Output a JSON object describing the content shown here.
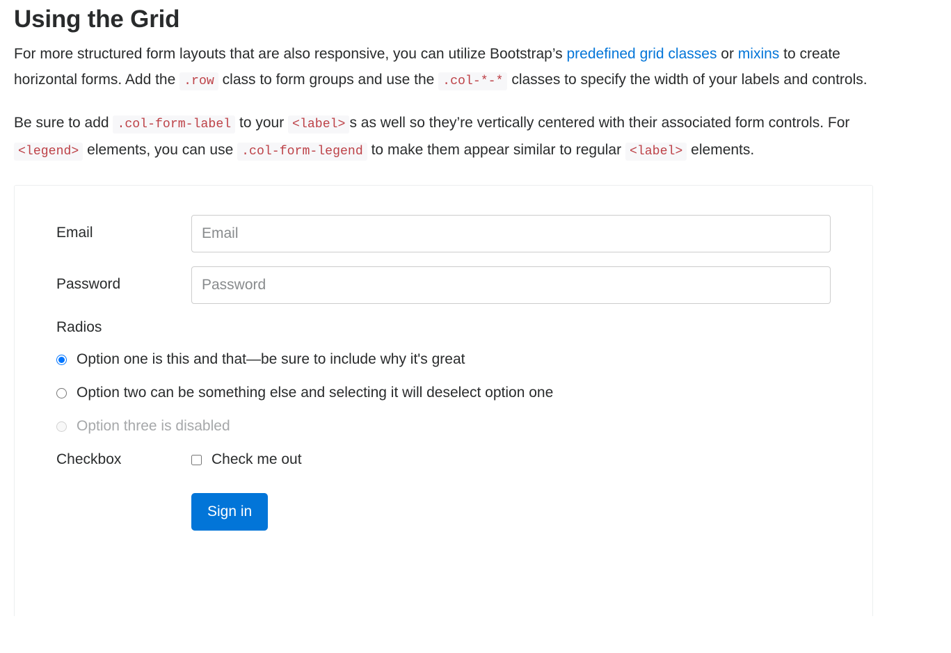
{
  "heading": "Using the Grid",
  "paragraph_1": {
    "seg_1": "For more structured form layouts that are also responsive, you can utilize Bootstrap’s ",
    "link_1": "predefined grid classes",
    "seg_2": " or ",
    "link_2": "mixins",
    "seg_3": " to create horizontal forms. Add the ",
    "code_1": ".row",
    "seg_4": " class to form groups and use the ",
    "code_2": ".col-*-*",
    "seg_5": " classes to specify the width of your labels and controls."
  },
  "paragraph_2": {
    "seg_1": "Be sure to add ",
    "code_1": ".col-form-label",
    "seg_2": " to your ",
    "code_2": "<label>",
    "seg_3": "s as well so they’re vertically centered with their associated form controls. For ",
    "code_3": "<legend>",
    "seg_4": " elements, you can use ",
    "code_4": ".col-form-legend",
    "seg_5": " to make them appear similar to regular ",
    "code_5": "<label>",
    "seg_6": " elements."
  },
  "form": {
    "email": {
      "label": "Email",
      "placeholder": "Email",
      "value": ""
    },
    "password": {
      "label": "Password",
      "placeholder": "Password",
      "value": ""
    },
    "radios": {
      "legend": "Radios",
      "options": [
        {
          "label": "Option one is this and that—be sure to include why it's great",
          "checked": true,
          "disabled": false
        },
        {
          "label": "Option two can be something else and selecting it will deselect option one",
          "checked": false,
          "disabled": false
        },
        {
          "label": "Option three is disabled",
          "checked": false,
          "disabled": true
        }
      ]
    },
    "checkbox": {
      "label": "Checkbox",
      "option_label": "Check me out",
      "checked": false
    },
    "submit_label": "Sign in"
  },
  "colors": {
    "text": "#292b2c",
    "link": "#0275d8",
    "code_text": "#bd4147",
    "code_bg": "#f7f7f9",
    "primary": "#0275d8",
    "border": "#eceeef",
    "input_border": "#cccccc",
    "muted": "#a6a8aa"
  }
}
